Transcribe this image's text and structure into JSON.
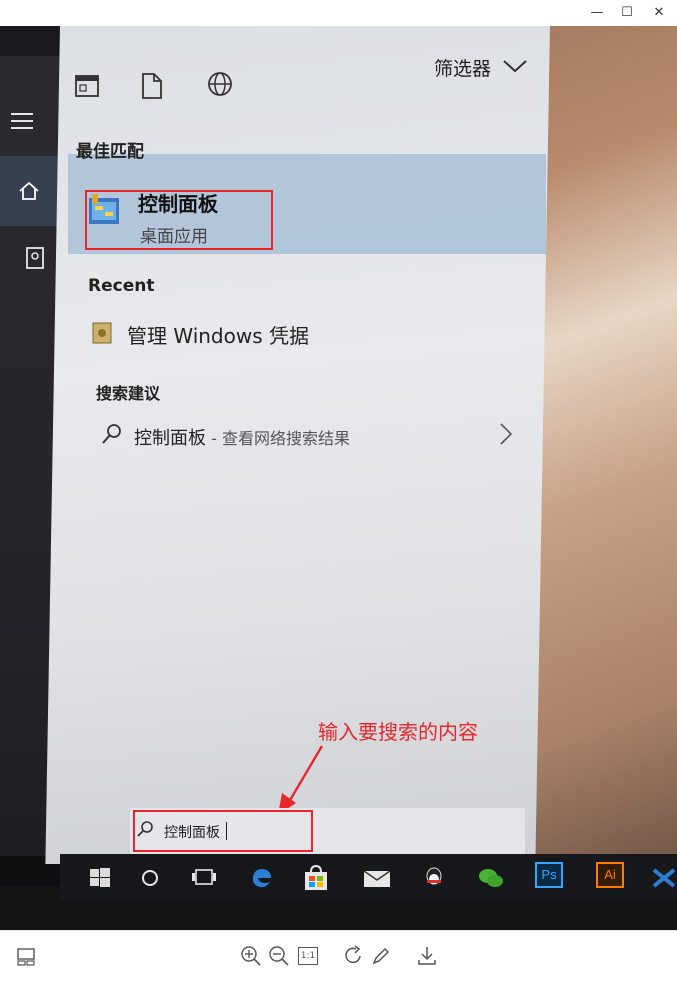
{
  "window": {
    "controls": [
      "minimize-icon",
      "maximize-icon",
      "close-icon"
    ]
  },
  "start_menu": {
    "filter_label": "筛选器",
    "best_match_header": "最佳匹配",
    "best_match": {
      "title": "控制面板",
      "subtitle": "桌面应用"
    },
    "recent_header": "Recent",
    "recent_items": [
      {
        "label": "管理 Windows 凭据"
      }
    ],
    "suggestions_header": "搜索建议",
    "suggestions": [
      {
        "label": "控制面板",
        "suffix": " - 查看网络搜索结果"
      }
    ],
    "search_value": "控制面板"
  },
  "annotation": {
    "text": "输入要搜索的内容",
    "color": "#e8262b"
  },
  "taskbar": {
    "ps_label": "Ps",
    "ai_label": "Ai"
  },
  "viewer_toolbar": {
    "ratio_label": "1:1"
  }
}
